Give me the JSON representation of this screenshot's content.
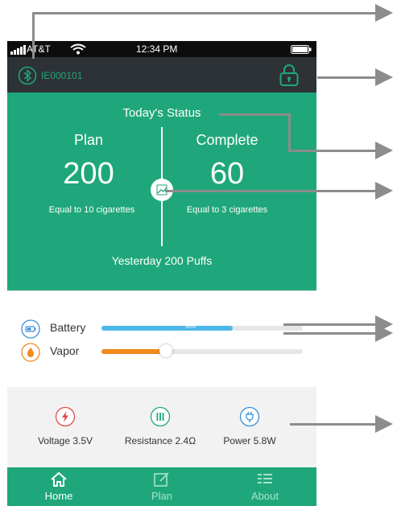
{
  "status_bar": {
    "carrier": "AT&T",
    "time": "12:34 PM"
  },
  "device_bar": {
    "device_id": "IE000101"
  },
  "status_panel": {
    "title": "Today's Status",
    "plan": {
      "label": "Plan",
      "value": "200",
      "sub": "Equal to 10 cigarettes"
    },
    "complete": {
      "label": "Complete",
      "value": "60",
      "sub": "Equal to 3 cigarettes"
    },
    "yesterday": "Yesterday 200 Puffs"
  },
  "battery": {
    "label": "Battery",
    "percent_text": "65%",
    "level": 0.65,
    "color": "#4bb8e8"
  },
  "vapor": {
    "label": "Vapor",
    "level": 0.32,
    "color": "#f08a1c"
  },
  "metrics": [
    {
      "label": "Voltage 3.5V",
      "icon": "lightning-icon",
      "color": "#e24b4b"
    },
    {
      "label": "Resistance 2.4Ω",
      "icon": "coil-icon",
      "color": "#1fa77b"
    },
    {
      "label": "Power 5.8W",
      "icon": "plug-icon",
      "color": "#3a8fd6"
    }
  ],
  "tabs": [
    {
      "label": "Home",
      "icon": "home-icon",
      "active": true
    },
    {
      "label": "Plan",
      "icon": "edit-icon",
      "active": false
    },
    {
      "label": "About",
      "icon": "list-icon",
      "active": false
    }
  ],
  "colors": {
    "accent": "#1fa77b",
    "dark_bar": "#2d3236",
    "annotation_arrow": "#8c8c8c"
  }
}
